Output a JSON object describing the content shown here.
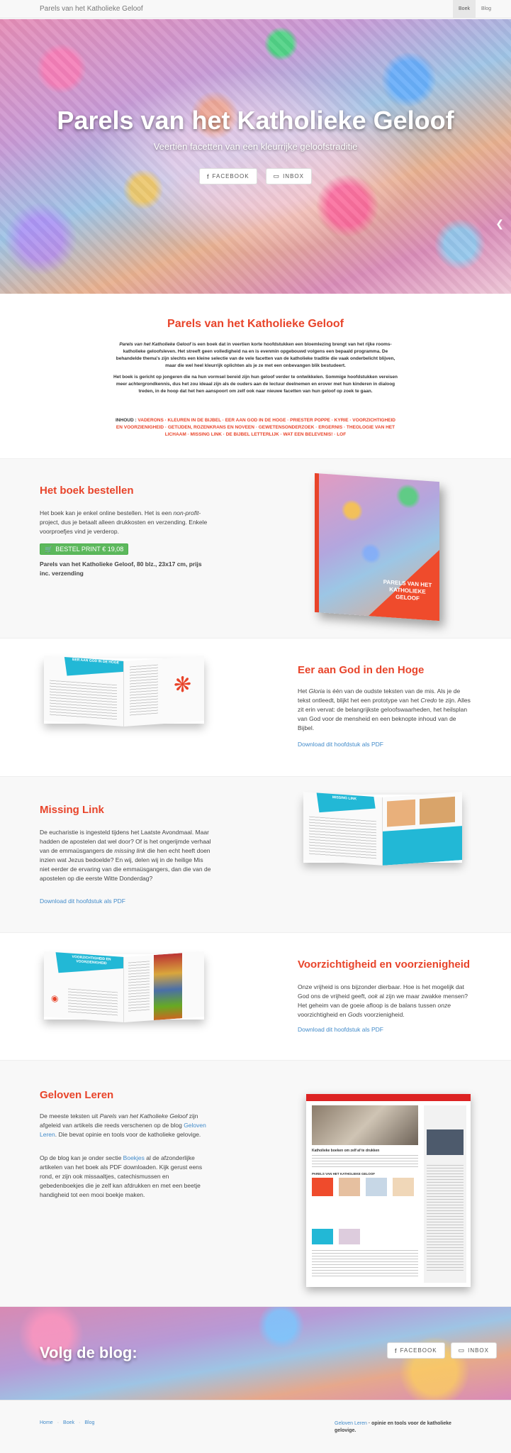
{
  "nav": {
    "brand": "Parels van het Katholieke Geloof",
    "links": [
      "Boek",
      "Blog"
    ]
  },
  "hero": {
    "title": "Parels van het Katholieke Geloof",
    "subtitle": "Veertien facetten van een kleurrijke geloofstraditie",
    "facebook": "FACEBOOK",
    "inbox": "INBOX"
  },
  "intro": {
    "title": "Parels van het Katholieke Geloof",
    "p1_em": "Parels van het Katholieke Geloof",
    "p1": " is een boek dat in veertien korte hoofdstukken een bloemlezing brengt van het rijke rooms-katholieke geloofsleven. Het streeft geen volledigheid na en is evenmin opgebouwd volgens een bepaald programma. De behandelde thema's zijn slechts een kleine selectie van de vele facetten van de katholieke traditie die vaak onderbelicht blijven, maar die wel heel kleurrijk oplichten als je ze met een onbevangen blik bestudeert.",
    "p2": "Het boek is gericht op jongeren die na hun vormsel bereid zijn hun geloof verder te ontwikkelen. Sommige hoofdstukken vereisen meer achtergrondkennis, dus het zou ideaal zijn als de ouders aan de lectuur deelnemen en erover met hun kinderen in dialoog treden, in de hoop dat het hen aanspoort om zelf ook naar nieuwe facetten van hun geloof op zoek te gaan.",
    "toc_label": "INHOUD : ",
    "toc": "VADERONS · KLEUREN IN DE BIJBEL · EER AAN GOD IN DE HOGE · PRIESTER POPPE · KYRIE · VOORZICHTIGHEID EN VOORZIENIGHEID · GETIJDEN, ROZENKRANS EN NOVEEN · GEWETENSONDERZOEK · ERGERNIS · THEOLOGIE VAN HET LICHAAM · MISSING LINK · DE BIJBEL LETTERLIJK · WAT EEN BELEVENIS! · LOF"
  },
  "order": {
    "title": "Het boek bestellen",
    "text_a": "Het boek kan je enkel online bestellen. Het is een ",
    "text_em": "non-profit",
    "text_b": "-project, dus je betaalt alleen drukkosten en verzending. Enkele voorproefjes vind je verderop.",
    "button": "BESTEL PRINT € 19,08",
    "details": "Parels van het Katholieke Geloof, 80 blz., 23x17 cm, prijs inc. verzending",
    "cover_title": "PARELS VAN HET KATHOLIEKE GELOOF"
  },
  "eer": {
    "title": "Eer aan God in den Hoge",
    "text_a": "Het ",
    "text_em1": "Gloria",
    "text_b": " is één van de oudste teksten van de mis. Als je de tekst ontleedt, blijkt het een prototype van het ",
    "text_em2": "Credo",
    "text_c": " te zijn. Alles zit erin vervat: de belangrijkste geloofswaarheden, het heilsplan van God voor de mensheid en een beknopte inhoud van de Bijbel.",
    "download": "Download dit hoofdstuk als PDF",
    "spread_label": "EER AAN GOD IN DE HOGE"
  },
  "missing": {
    "title": "Missing Link",
    "text_a": "De eucharistie is ingesteld tijdens het Laatste Avondmaal. Maar hadden de apostelen dat wel door? Of is het ongerijmde verhaal van de emmaüsgangers de ",
    "text_em": "missing link",
    "text_b": " die hen echt heeft doen inzien wat Jezus bedoelde? En wij, delen wij in de heilige Mis niet eerder de ervaring van die emmaüsgangers, dan die van de apostelen op die eerste Witte Donderdag?",
    "download": "Download dit hoofdstuk als PDF",
    "spread_label": "MISSING LINK"
  },
  "voorz": {
    "title": "Voorzichtigheid en voorzienigheid",
    "text_a": "Onze vrijheid is ons bijzonder dierbaar. Hoe is het mogelijk dat God ons de vrijheid geeft, ",
    "text_em1": "ook",
    "text_b": " al zijn we maar zwakke mensen? Het geheim van de goeie afloop is de balans tussen ",
    "text_em2": "onze",
    "text_c": " voorzichtigheid en ",
    "text_em3": "Gods",
    "text_d": " voorzienigheid.",
    "download": "Download dit hoofdstuk als PDF",
    "spread_label": "VOORZICHTIGHEID EN VOORZIENIGHEID"
  },
  "leren": {
    "title": "Geloven Leren",
    "text_a": "De meeste teksten uit ",
    "text_em": "Parels van het Katholieke Geloof",
    "text_b": " zijn afgeleid van artikels die reeds verschenen op de blog ",
    "link1": "Geloven Leren",
    "text_c": ". Die bevat opinie en tools voor de katholieke gelovige.",
    "text_d": "Op de blog kan je onder sectie ",
    "link2": "Boekjes",
    "text_e": " al de afzonderlijke artikelen van het boek als PDF downloaden. Kijk gerust eens rond, er zijn ook missaaltjes, catechismussen en gebedenboekjes die je zelf kan afdrukken en met een beetje handigheid tot een mooi boekje maken.",
    "shot_heading": "Katholieke boeken om zelf af te drukken",
    "shot_sub": "PARELS VAN HET KATHOLIEKE GELOOF"
  },
  "follow": {
    "title": "Volg de blog:",
    "facebook": "FACEBOOK",
    "inbox": "INBOX"
  },
  "footer": {
    "links": [
      "Home",
      "Boek",
      "Blog"
    ],
    "right_link": "Geloven Leren",
    "right_text": " · opinie en tools voor de katholieke gelovige."
  },
  "colors": {
    "accent": "#e8442a",
    "link": "#428bca",
    "button_green": "#5cb85c"
  }
}
